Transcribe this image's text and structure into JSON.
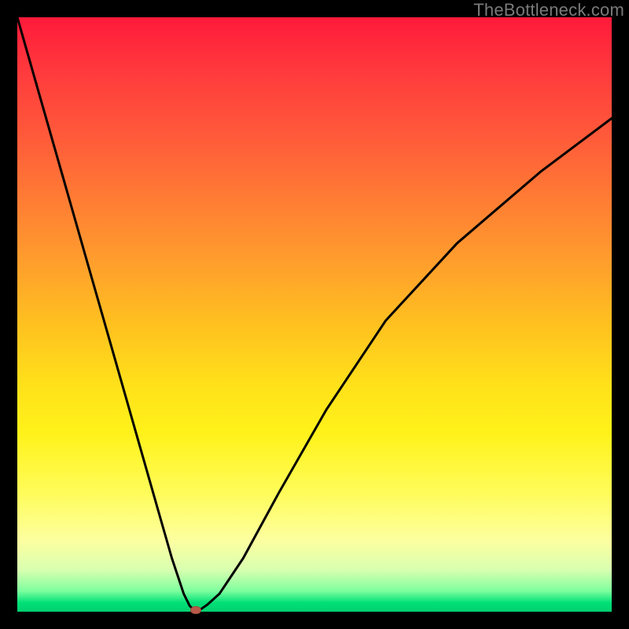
{
  "watermark": "TheBottleneck.com",
  "chart_data": {
    "type": "line",
    "title": "",
    "xlabel": "",
    "ylabel": "",
    "xlim": [
      0,
      100
    ],
    "ylim": [
      0,
      100
    ],
    "grid": false,
    "legend": false,
    "background_gradient": {
      "direction": "vertical",
      "stops": [
        {
          "pos": 0,
          "color": "#ff1a3a"
        },
        {
          "pos": 50,
          "color": "#ffc21f"
        },
        {
          "pos": 80,
          "color": "#fffc5a"
        },
        {
          "pos": 100,
          "color": "#00d070"
        }
      ]
    },
    "series": [
      {
        "name": "bottleneck-curve",
        "x": [
          0,
          4,
          8,
          12,
          16,
          20,
          24,
          26,
          28,
          29,
          30,
          31,
          32,
          34,
          38,
          44,
          52,
          62,
          74,
          88,
          100
        ],
        "y": [
          100,
          86,
          72,
          58,
          44,
          30,
          16,
          9,
          3,
          1,
          0,
          0.5,
          1.2,
          3,
          9,
          20,
          34,
          49,
          62,
          74,
          83
        ]
      }
    ],
    "marker": {
      "name": "optimal-point",
      "x": 30,
      "y": 0,
      "color": "#b85a4a"
    }
  }
}
